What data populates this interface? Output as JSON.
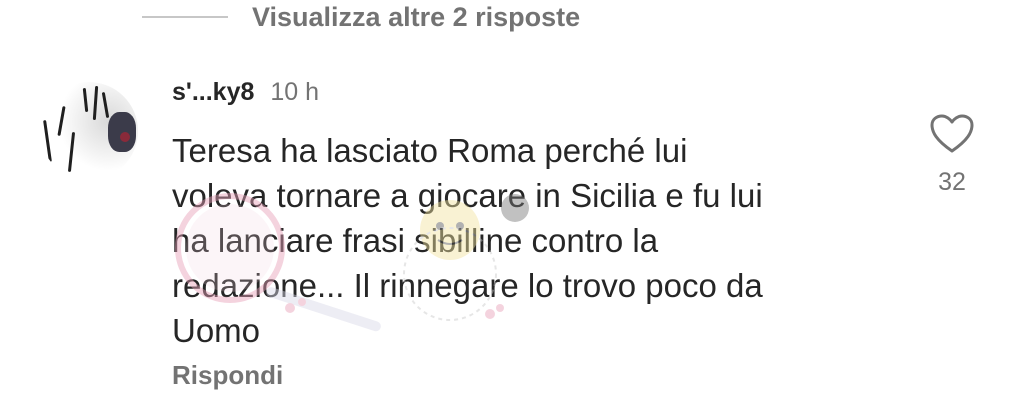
{
  "thread": {
    "view_more_label": "Visualizza altre 2 risposte"
  },
  "comment": {
    "username": "s'...ky8",
    "timestamp": "10 h",
    "text": "Teresa ha lasciato Roma perché lui\nvoleva tornare a giocare in Sicilia e fu lui\nha lanciare frasi sibilline contro la\nredazione... Il rinnegare lo trovo poco da\nUomo",
    "reply_label": "Rispondi",
    "like_count": "32",
    "like_icon": "heart-outline-icon"
  },
  "colors": {
    "text_primary": "#262626",
    "text_secondary": "#737373",
    "thread_line": "#c7c7c7",
    "watermark": "#e8a0b8"
  }
}
